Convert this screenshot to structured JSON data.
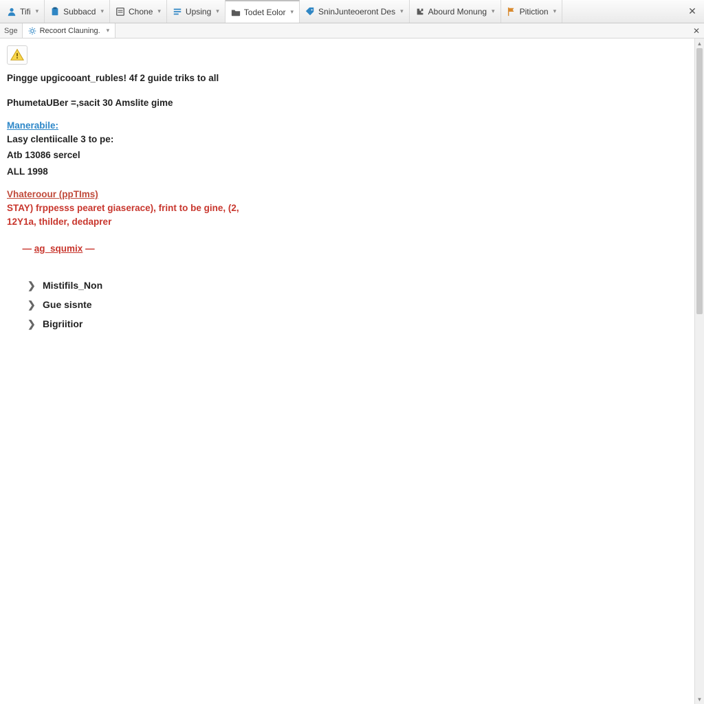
{
  "toolbar": {
    "items": [
      {
        "icon": "person-icon",
        "icon_color": "#2f86c4",
        "label": "Tifi"
      },
      {
        "icon": "clipboard-icon",
        "icon_color": "#2f86c4",
        "label": "Subbacd"
      },
      {
        "icon": "list-icon",
        "icon_color": "#5a5a5a",
        "label": "Chone"
      },
      {
        "icon": "lines-icon",
        "icon_color": "#2f86c4",
        "label": "Upsing"
      },
      {
        "icon": "folder-icon",
        "icon_color": "#5a5a5a",
        "label": "Todet Eolor",
        "active": true
      },
      {
        "icon": "tag-icon",
        "icon_color": "#2f86c4",
        "label": "SninJunteoeront Des"
      },
      {
        "icon": "puzzle-icon",
        "icon_color": "#5a5a5a",
        "label": "Abourd Monung"
      },
      {
        "icon": "flag-icon",
        "icon_color": "#d98a2e",
        "label": "Pitiction"
      }
    ]
  },
  "tabstrip": {
    "ghost_label": "Sge",
    "tab": {
      "label": "Recoort Clauning.",
      "icon_name": "gear-icon"
    }
  },
  "content": {
    "warning_icon": "⚠",
    "lines": {
      "l1": "Pingge upgicooant_rubles! 4f 2 guide triks to all",
      "l2": "PhumetaUBer =,sacit 30 Amslite gime"
    },
    "section_a": {
      "heading": "Manerabile:",
      "r1": "Lasy clentiicalle 3 to pe:",
      "r2": "Atb 13086 sercel",
      "r3": "ALL 1998"
    },
    "section_b": {
      "heading": "Vhateroour (ppTIms)",
      "r1": "STAY) frppesss pearet giaserace), frint to be gine, (2,",
      "r2": "12Y1a, thilder, dedaprer",
      "r3_prefix": "— ",
      "r3_link": "ag_squmix",
      "r3_suffix": " —"
    },
    "tree": [
      "Mistifils_Non",
      "Gue sisnte",
      "Bigriitior"
    ]
  }
}
